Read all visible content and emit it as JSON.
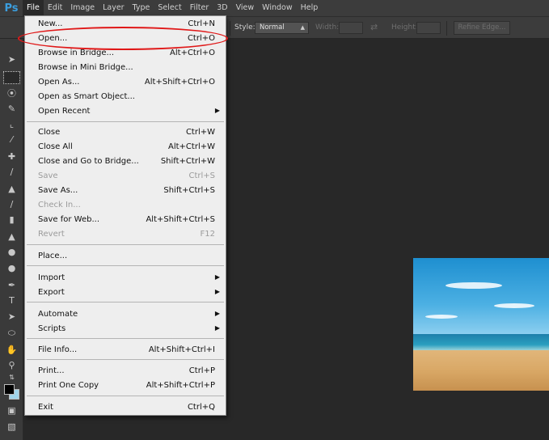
{
  "app": {
    "logo": "Ps"
  },
  "menubar": [
    "File",
    "Edit",
    "Image",
    "Layer",
    "Type",
    "Select",
    "Filter",
    "3D",
    "View",
    "Window",
    "Help"
  ],
  "options": {
    "style_label": "Style:",
    "style_value": "Normal",
    "width_label": "Width:",
    "height_label": "Height:",
    "refine_edge": "Refine Edge..."
  },
  "file_menu": {
    "new": {
      "label": "New...",
      "shortcut": "Ctrl+N"
    },
    "open": {
      "label": "Open...",
      "shortcut": "Ctrl+O"
    },
    "browse_bridge": {
      "label": "Browse in Bridge...",
      "shortcut": "Alt+Ctrl+O"
    },
    "browse_mini_bridge": {
      "label": "Browse in Mini Bridge...",
      "shortcut": ""
    },
    "open_as": {
      "label": "Open As...",
      "shortcut": "Alt+Shift+Ctrl+O"
    },
    "open_smart_object": {
      "label": "Open as Smart Object...",
      "shortcut": ""
    },
    "open_recent": {
      "label": "Open Recent",
      "shortcut": ""
    },
    "close": {
      "label": "Close",
      "shortcut": "Ctrl+W"
    },
    "close_all": {
      "label": "Close All",
      "shortcut": "Alt+Ctrl+W"
    },
    "close_go_bridge": {
      "label": "Close and Go to Bridge...",
      "shortcut": "Shift+Ctrl+W"
    },
    "save": {
      "label": "Save",
      "shortcut": "Ctrl+S"
    },
    "save_as": {
      "label": "Save As...",
      "shortcut": "Shift+Ctrl+S"
    },
    "check_in": {
      "label": "Check In...",
      "shortcut": ""
    },
    "save_for_web": {
      "label": "Save for Web...",
      "shortcut": "Alt+Shift+Ctrl+S"
    },
    "revert": {
      "label": "Revert",
      "shortcut": "F12"
    },
    "place": {
      "label": "Place...",
      "shortcut": ""
    },
    "import": {
      "label": "Import",
      "shortcut": ""
    },
    "export": {
      "label": "Export",
      "shortcut": ""
    },
    "automate": {
      "label": "Automate",
      "shortcut": ""
    },
    "scripts": {
      "label": "Scripts",
      "shortcut": ""
    },
    "file_info": {
      "label": "File Info...",
      "shortcut": "Alt+Shift+Ctrl+I"
    },
    "print": {
      "label": "Print...",
      "shortcut": "Ctrl+P"
    },
    "print_one": {
      "label": "Print One Copy",
      "shortcut": "Alt+Shift+Ctrl+P"
    },
    "exit": {
      "label": "Exit",
      "shortcut": "Ctrl+Q"
    }
  },
  "colors": {
    "accent": "#3b9ede",
    "highlight": "#e01818",
    "foreground": "#000000",
    "background": "#a0d4ea"
  }
}
